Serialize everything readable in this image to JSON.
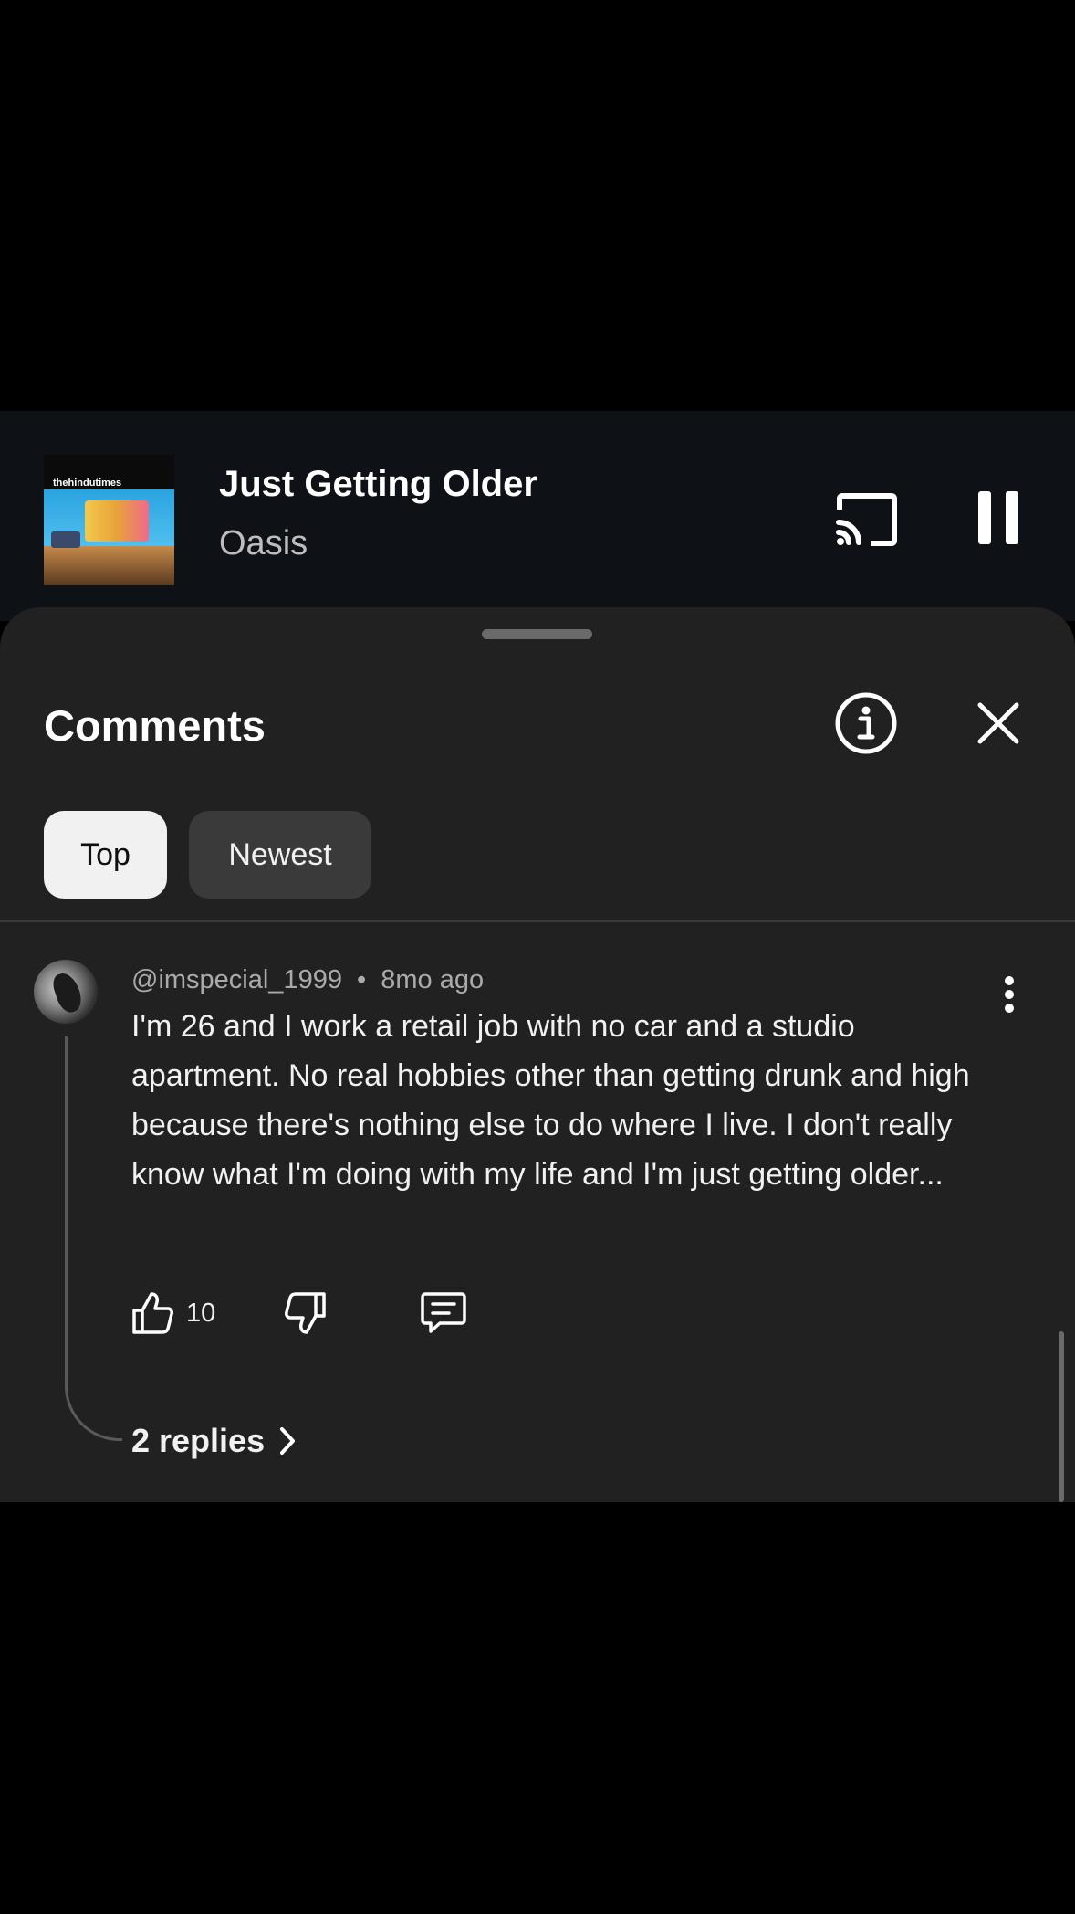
{
  "now_playing": {
    "album_art_text": "thehindutimes",
    "title": "Just Getting Older",
    "artist": "Oasis",
    "icons": {
      "cast": "cast-icon",
      "pause": "pause-icon"
    }
  },
  "comments_panel": {
    "title": "Comments",
    "icons": {
      "info": "info-icon",
      "close": "close-icon"
    },
    "sort_chips": [
      {
        "label": "Top",
        "selected": true
      },
      {
        "label": "Newest",
        "selected": false
      }
    ]
  },
  "comments": [
    {
      "author": "@imspecial_1999",
      "separator": "•",
      "time": "8mo ago",
      "text": "I'm 26 and I work a retail job with no car and a studio apartment. No real hobbies other than getting drunk and high because there's nothing else to do where I live. I don't really know what I'm doing with my life and I'm just getting older...",
      "likes": "10",
      "replies_label": "2 replies"
    }
  ],
  "colors": {
    "background": "#000000",
    "player_bg": "#0e1116",
    "sheet_bg": "#212121",
    "chip_selected_bg": "#f1f1f1",
    "chip_bg": "#3a3a3a",
    "text_primary": "#f1f1f1",
    "text_secondary": "#aaaaaa"
  }
}
